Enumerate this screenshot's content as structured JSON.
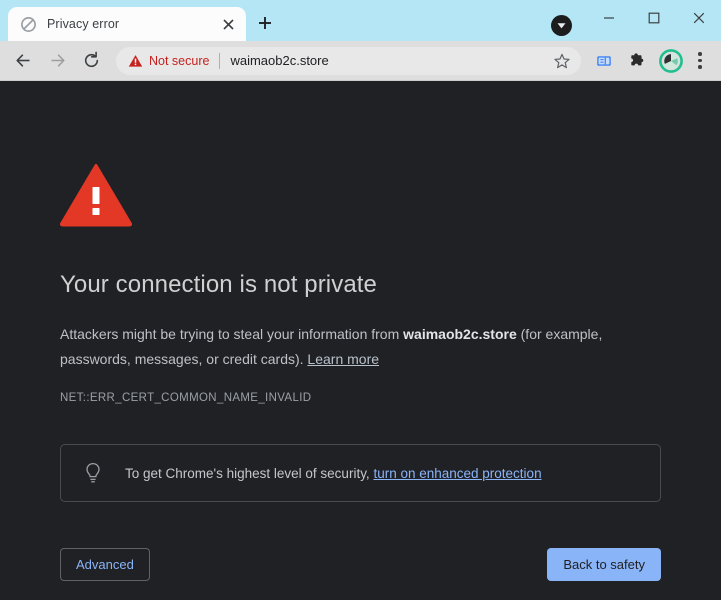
{
  "window": {
    "controls": {
      "minimize_label": "Minimize",
      "maximize_label": "Maximize",
      "close_label": "Close"
    }
  },
  "tabstrip": {
    "tabs": [
      {
        "title": "Privacy error",
        "favicon": "blocked-circle-icon",
        "close_label": "Close tab"
      }
    ],
    "new_tab_label": "New tab",
    "tab_search_label": "Search tabs"
  },
  "toolbar": {
    "back_label": "Back",
    "forward_label": "Forward",
    "reload_label": "Reload",
    "security": {
      "icon": "warning-triangle-icon",
      "label": "Not secure"
    },
    "url": "waimaob2c.store",
    "bookmark_label": "Bookmark this tab",
    "side_panel_label": "Side panel",
    "extensions_label": "Extensions",
    "profile_label": "Profile",
    "menu_label": "Customize and control Google Chrome"
  },
  "page": {
    "icon": "red-warning-triangle-icon",
    "title": "Your connection is not private",
    "body": {
      "lead": "Attackers might be trying to steal your information from ",
      "domain": "waimaob2c.store",
      "rest": " (for example, passwords, messages, or credit cards). ",
      "learn_more": "Learn more"
    },
    "error_code": "NET::ERR_CERT_COMMON_NAME_INVALID",
    "safety_tip": {
      "icon": "lightbulb-icon",
      "text": "To get Chrome's highest level of security, ",
      "link": "turn on enhanced protection"
    },
    "buttons": {
      "advanced": "Advanced",
      "back_to_safety": "Back to safety"
    }
  },
  "colors": {
    "tabstrip_bg": "#b5e6f5",
    "toolbar_bg": "#dedede",
    "page_bg": "#202124",
    "warning_red": "#d93025",
    "not_secure_red": "#c5221f",
    "link_blue": "#8ab4f8",
    "profile_green": "#1fc08e"
  }
}
